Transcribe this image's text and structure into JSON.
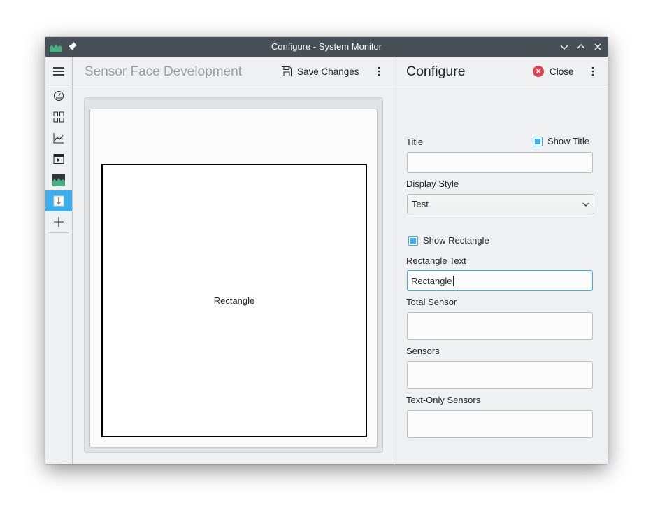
{
  "window": {
    "title": "Configure - System Monitor"
  },
  "sidebar": {
    "items": [
      {
        "icon": "menu-icon"
      },
      {
        "icon": "gauge-icon"
      },
      {
        "icon": "grid-icon"
      },
      {
        "icon": "line-chart-icon"
      },
      {
        "icon": "window-play-icon"
      },
      {
        "icon": "area-chart-icon"
      },
      {
        "icon": "brush-icon",
        "active": true
      },
      {
        "icon": "plus-icon"
      }
    ],
    "active_color": "#3daee9"
  },
  "center": {
    "title": "Sensor Face Development",
    "save_label": "Save Changes",
    "preview": {
      "rectangle_text": "Rectangle"
    }
  },
  "config": {
    "title": "Configure",
    "close_label": "Close",
    "title_label": "Title",
    "title_value": "",
    "show_title_label": "Show Title",
    "show_title_checked": true,
    "display_style_label": "Display Style",
    "display_style_value": "Test",
    "show_rectangle_label": "Show Rectangle",
    "show_rectangle_checked": true,
    "rectangle_text_label": "Rectangle Text",
    "rectangle_text_value": "Rectangle",
    "total_sensor_label": "Total Sensor",
    "sensors_label": "Sensors",
    "text_only_sensors_label": "Text-Only Sensors"
  },
  "colors": {
    "titlebar": "#475057",
    "accent": "#3daee9",
    "close_red": "#da4453"
  }
}
